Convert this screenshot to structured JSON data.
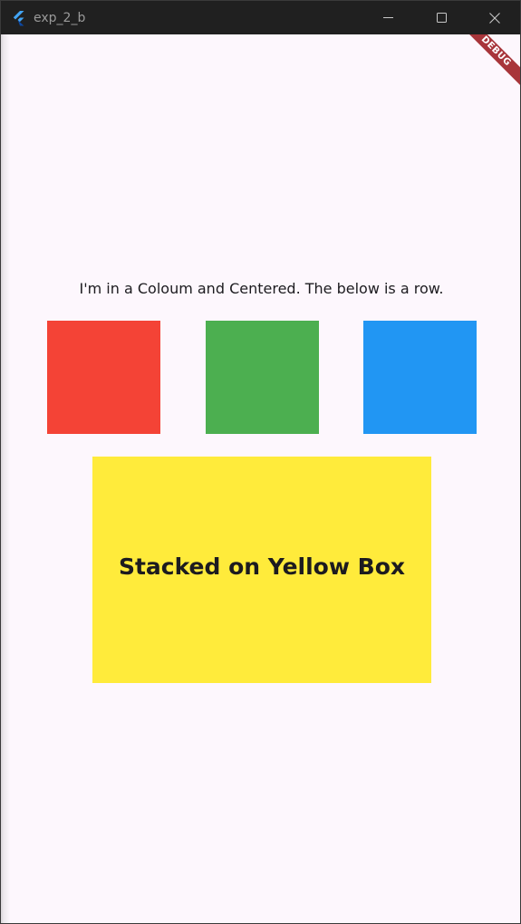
{
  "window": {
    "title": "exp_2_b",
    "icons": {
      "app": "flutter-logo-icon",
      "minimize": "minimize-icon",
      "maximize": "maximize-icon",
      "close": "close-icon"
    }
  },
  "debug_banner": {
    "label": "DEBUG",
    "color": "#a8353a"
  },
  "main": {
    "caption": "I'm in a Coloum and Centered. The below is a row.",
    "row_boxes": [
      {
        "color": "#f44336",
        "name": "red"
      },
      {
        "color": "#4caf50",
        "name": "green"
      },
      {
        "color": "#2196f3",
        "name": "blue"
      }
    ],
    "stack": {
      "label": "Stacked on Yellow Box",
      "color": "#ffeb3b"
    }
  },
  "colors": {
    "background": "#fdf7fd",
    "titlebar": "#202020",
    "text": "#1c1b1f"
  }
}
